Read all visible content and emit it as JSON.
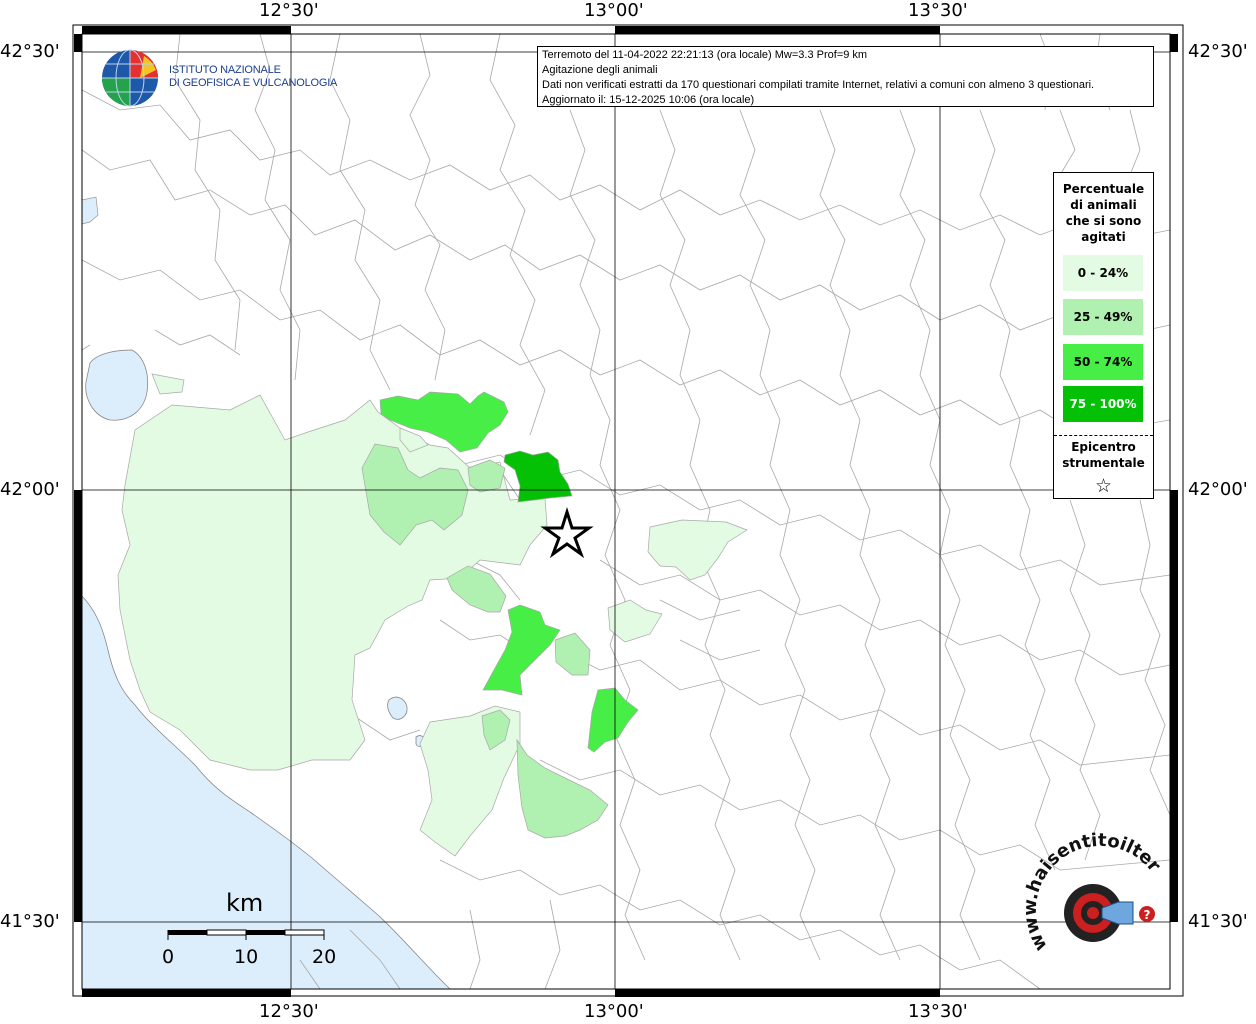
{
  "header": {
    "line1": "Terremoto del 11-04-2022 22:21:13 (ora locale) Mw=3.3 Prof=9 km",
    "line2": "Agitazione degli animali",
    "line3": "Dati non verificati estratti da 170 questionari compilati tramite Internet, relativi a comuni con almeno 3 questionari.",
    "line4": "Aggiornato il: 15-12-2025 10:06 (ora locale)"
  },
  "institute": {
    "line1": "ISTITUTO NAZIONALE",
    "line2": "DI GEOFISICA E VULCANOLOGIA"
  },
  "legend": {
    "title_l1": "Percentuale",
    "title_l2": "di animali",
    "title_l3": "che si sono",
    "title_l4": "agitati",
    "items": [
      {
        "label": "0 - 24%",
        "color": "#e2fbe2"
      },
      {
        "label": "25 - 49%",
        "color": "#b0f0b0"
      },
      {
        "label": "50 - 74%",
        "color": "#46ee46"
      },
      {
        "label": "75 - 100%",
        "color": "#05c105"
      }
    ],
    "epicenter_l1": "Epicentro",
    "epicenter_l2": "strumentale",
    "epicenter_symbol": "☆"
  },
  "axes": {
    "lon_labels": [
      "12°30'",
      "13°00'",
      "13°30'"
    ],
    "lat_labels": [
      "42°30'",
      "42°00'",
      "41°30'"
    ]
  },
  "scale_bar": {
    "unit": "km",
    "labels": [
      "0",
      "10",
      "20"
    ]
  },
  "logo_hst": {
    "text": "haisentitoilterremoto.it",
    "url_text": "www.",
    "accent_color": "#cc1f1f"
  },
  "colors": {
    "sea": "#dcedfb",
    "land": "#ffffff",
    "borders": "#a8a8a8",
    "grid": "#000000"
  }
}
